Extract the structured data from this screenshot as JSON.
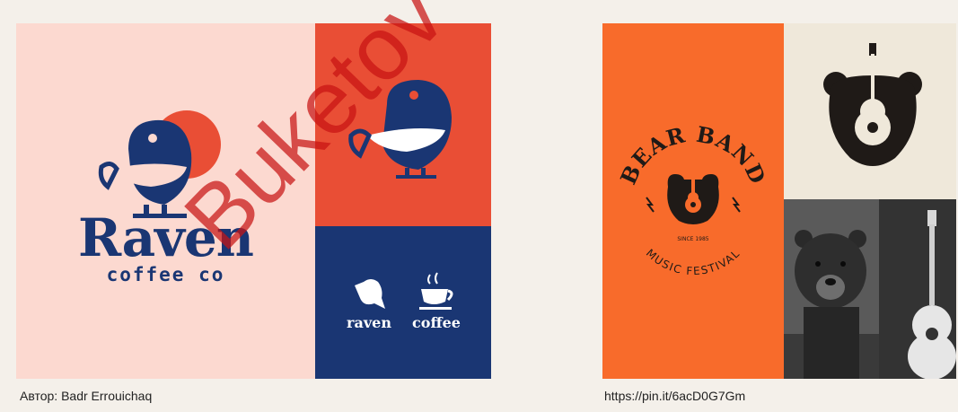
{
  "left_board": {
    "wordmark": "Raven",
    "tagline": "coffee co",
    "label_raven": "raven",
    "label_coffee": "coffee",
    "caption": "Автор: Badr Errouichaq"
  },
  "right_board": {
    "badge_top": "BEAR BAND",
    "badge_since": "SINCE 1985",
    "badge_bottom": "MUSIC FESTIVAL",
    "caption": "https://pin.it/6acD0G7Gm"
  },
  "watermark": "Buketov",
  "colors": {
    "pink": "#fcd9d0",
    "red": "#e94e35",
    "navy": "#1a3673",
    "orange": "#f86b2b",
    "cream": "#efe8da",
    "dark": "#1f1a17"
  },
  "icons": [
    "raven-cup-logo",
    "raven-bird-icon",
    "coffee-cup-icon",
    "bear-guitar-logo"
  ]
}
